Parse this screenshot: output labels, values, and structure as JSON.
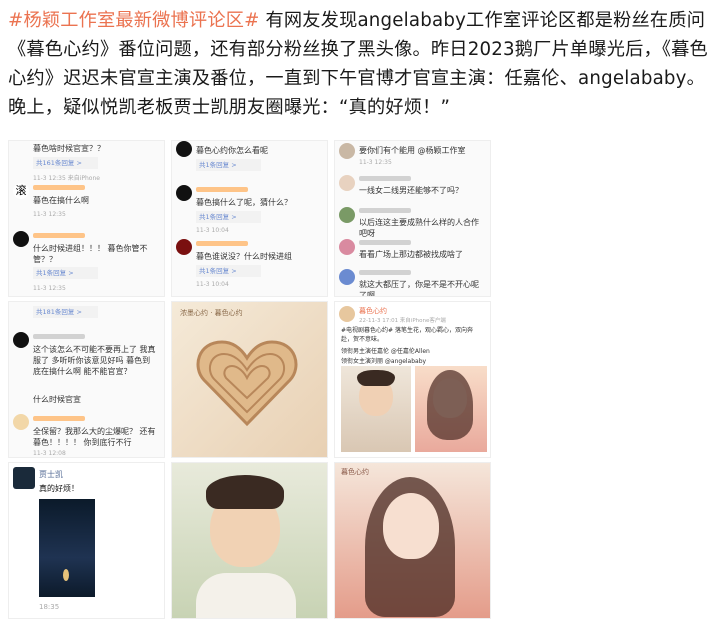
{
  "post": {
    "hashtag": "#杨颖工作室最新微博评论区#",
    "body": "有网友发现angelababy工作室评论区都是粉丝在质问《暮色心约》番位问题，还有部分粉丝换了黑头像。昨日2023鹅厂片单曝光后，《暮色心约》迟迟未官宣主演及番位，一直到下午官博才官宣主演：任嘉伦、angelababy。晚上，疑似悦凯老板贾士凯朋友圈曝光：“真的好烦！”"
  },
  "cells": {
    "c1": {
      "comments": [
        {
          "text": "暮色啥时候官宣？？",
          "meta": "11-3 12:35 来自iPhone",
          "reply": "共161条回复 >"
        },
        {
          "text": "暮色在搞什么啊",
          "meta": "11-3 12:35",
          "reply": ""
        },
        {
          "text": "什么时候进组！！！ 暮色你管不管？？",
          "meta": "11-3 12:35",
          "reply": "共1条回复 >"
        }
      ]
    },
    "c2": {
      "comments": [
        {
          "text": "暮色心约你怎么看呢",
          "meta": "",
          "reply": "共1条回复 >"
        },
        {
          "text": "暮色搞什么了呢，猜什么？",
          "meta": "11-3 10:04",
          "reply": "共1条回复 >"
        },
        {
          "text": "暮色谁说没？什么时候进组",
          "meta": "11-3 10:04",
          "reply": "共1条回复 >"
        }
      ]
    },
    "c3": {
      "comments": [
        {
          "text": "要你们有个能用 @杨颖工作室",
          "meta": "11-3 12:35",
          "reply": ""
        },
        {
          "text": "一线女二线男还能够不了吗？",
          "meta": "",
          "reply": ""
        },
        {
          "text": "以后连这主要成熟什么样的人合作吧呀",
          "meta": "",
          "reply": ""
        },
        {
          "text": "看看广场上那边都被找成啥了",
          "meta": "",
          "reply": ""
        },
        {
          "text": "就这大都压了，你是不是不开心呢了啊",
          "meta": "",
          "reply": ""
        }
      ]
    },
    "c4": {
      "comments": [
        {
          "text": "这个该怎么不可能不要再上了 我真服了 多听听你该意见好吗 暮色到底在搞什么啊 能不能官宣？",
          "meta": "11-3 12:08",
          "reply": "共181条回复 >"
        },
        {
          "text": "什么时候官宣",
          "meta": "11-3 12:08",
          "reply": ""
        },
        {
          "text": "全保留？我那么大的尘爆呢？ 还有暮色！！！！ 你到底行不行",
          "meta": "11-3 12:08",
          "reply": ""
        }
      ]
    },
    "c5": {
      "caption": "浓墨心约 · 暮色心约"
    },
    "c6": {
      "account": "暮色心约",
      "time": "22-11-3 17:01 来自iPhone客户端",
      "lines": [
        "#电视剧暮色心约# 落笔生花，观心羁心，双向奔赴，贺不意味。",
        "领衔男主演任嘉伦 @任嘉伦Allen",
        "领衔女主演刘丽 @angelababy"
      ]
    },
    "c7": {
      "name": "贾士凯",
      "text": "真的好烦！",
      "time": "18:35"
    },
    "c9": {
      "caption": "暮色心约"
    }
  },
  "colors": {
    "hashtag": "#eb7350",
    "link": "#6b8bd1"
  }
}
